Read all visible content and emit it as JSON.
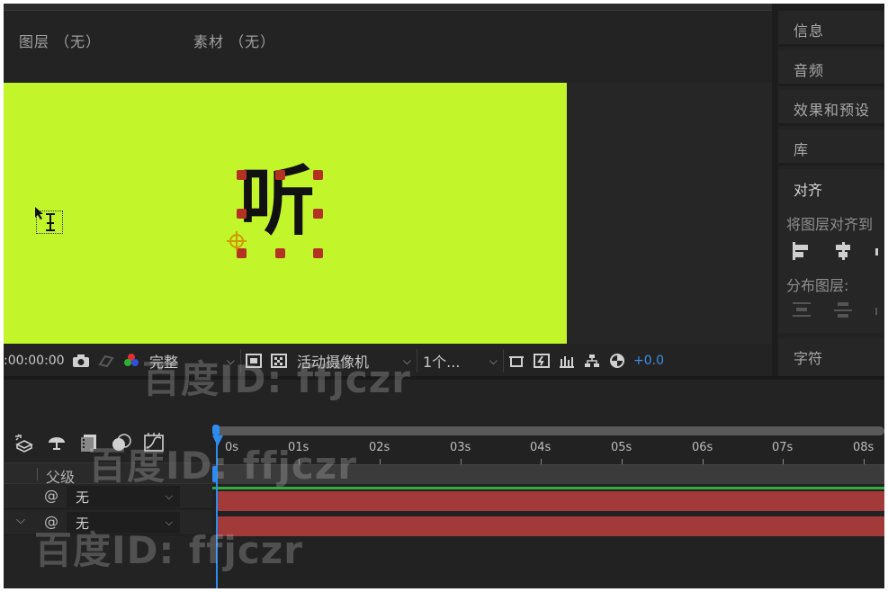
{
  "viewer": {
    "tab_layer": "图层 （无）",
    "tab_footage": "素材 （无）",
    "canvas_text": "听",
    "canvas_color": "#c3f52b"
  },
  "viewer_toolbar": {
    "timecode": ":00:00:00",
    "resolution": "完整",
    "camera": "活动摄像机",
    "views": "1个...",
    "exposure": "+0.0"
  },
  "right_panel": {
    "items": [
      "信息",
      "音频",
      "效果和预设",
      "库"
    ],
    "align": {
      "title": "对齐",
      "align_to_label": "将图层对齐到",
      "distribute_label": "分布图层:"
    },
    "character": "字符"
  },
  "timeline": {
    "parent_header": "父级",
    "rows": [
      {
        "parent": "无"
      },
      {
        "parent": "无"
      }
    ],
    "ruler_ticks": [
      "0s",
      "01s",
      "02s",
      "03s",
      "04s",
      "05s",
      "06s",
      "07s",
      "08s"
    ]
  },
  "watermark": {
    "text": "百度ID: ffjczr"
  },
  "colors": {
    "accent_blue": "#2d8cf0",
    "layer_red": "#a33a3a",
    "handle_red": "#b43222"
  }
}
